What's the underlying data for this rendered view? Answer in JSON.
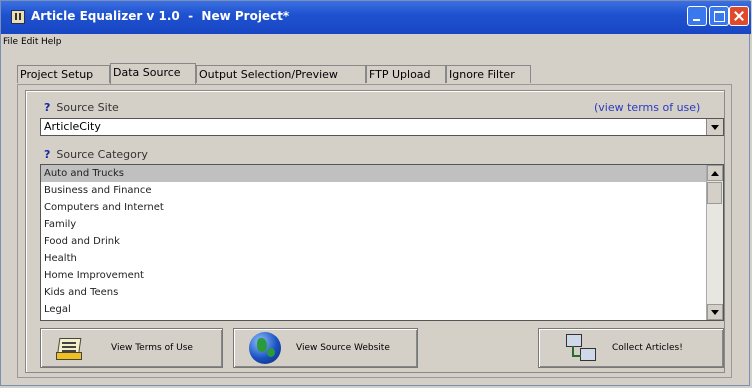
{
  "window": {
    "title": "Article Equalizer v 1.0  -  New Project*"
  },
  "menu": [
    {
      "label": "File"
    },
    {
      "label": "Edit"
    },
    {
      "label": "Help"
    }
  ],
  "tabs": [
    {
      "label": "Project Setup"
    },
    {
      "label": "Data Source"
    },
    {
      "label": "Output Selection/Preview"
    },
    {
      "label": "FTP Upload"
    },
    {
      "label": "Ignore Filter"
    }
  ],
  "active_tab": "Data Source",
  "source_site": {
    "help": "?",
    "label": "Source Site",
    "terms_link": "(view terms of use)",
    "value": "ArticleCity"
  },
  "source_category": {
    "help": "?",
    "label": "Source Category",
    "items": [
      "Auto and Trucks",
      "Business and Finance",
      "Computers and Internet",
      "Family",
      "Food and Drink",
      "Health",
      "Home Improvement",
      "Kids and Teens",
      "Legal"
    ],
    "selected": "Auto and Trucks"
  },
  "buttons": {
    "view_terms": {
      "label": "View Terms of Use",
      "icon": "document-icon"
    },
    "view_source": {
      "label": "View Source Website",
      "icon": "globe-icon"
    },
    "collect": {
      "label": "Collect Articles!",
      "icon": "network-computers-icon"
    }
  }
}
